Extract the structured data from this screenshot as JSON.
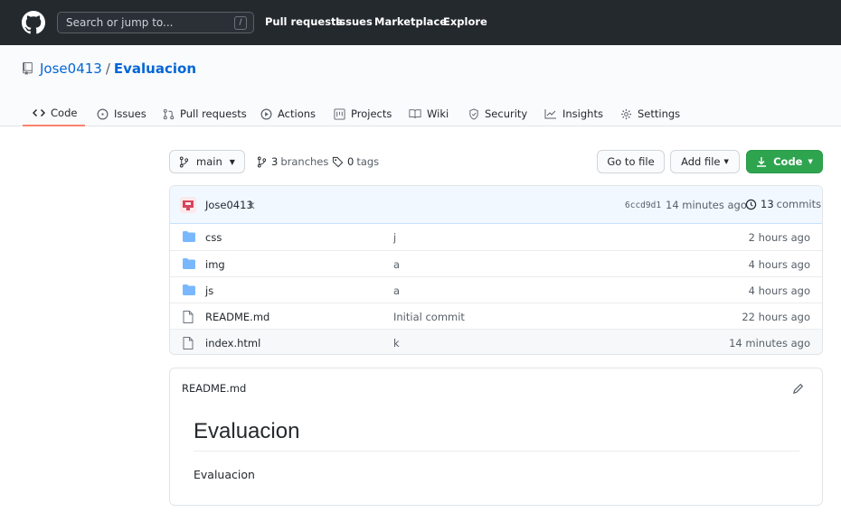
{
  "header": {
    "search_placeholder": "Search or jump to...",
    "search_shortcut": "/",
    "nav": [
      "Pull requests",
      "Issues",
      "Marketplace",
      "Explore"
    ]
  },
  "repo": {
    "owner": "Jose0413",
    "separator": "/",
    "name": "Evaluacion"
  },
  "tabs": [
    "Code",
    "Issues",
    "Pull requests",
    "Actions",
    "Projects",
    "Wiki",
    "Security",
    "Insights",
    "Settings"
  ],
  "toolbar": {
    "branch": "main",
    "branches_count": "3",
    "branches_label": "branches",
    "tags_count": "0",
    "tags_label": "tags",
    "goto_file": "Go to file",
    "add_file": "Add file",
    "code": "Code"
  },
  "commit": {
    "author": "Jose0413",
    "message": "k",
    "sha": "6ccd9d1",
    "time": "14 minutes ago",
    "commits_count": "13",
    "commits_label": "commits"
  },
  "files": [
    {
      "name": "css",
      "type": "dir",
      "message": "j",
      "age": "2 hours ago"
    },
    {
      "name": "img",
      "type": "dir",
      "message": "a",
      "age": "4 hours ago"
    },
    {
      "name": "js",
      "type": "dir",
      "message": "a",
      "age": "4 hours ago"
    },
    {
      "name": "README.md",
      "type": "file",
      "message": "Initial commit",
      "age": "22 hours ago"
    },
    {
      "name": "index.html",
      "type": "file",
      "message": "k",
      "age": "14 minutes ago"
    }
  ],
  "readme": {
    "filename": "README.md",
    "heading": "Evaluacion",
    "body": "Evaluacion"
  },
  "colors": {
    "header_bg": "#24292e",
    "link": "#0366d6",
    "green_button": "#2ea44f",
    "active_tab": "#f9826c",
    "folder": "#79b8ff"
  }
}
